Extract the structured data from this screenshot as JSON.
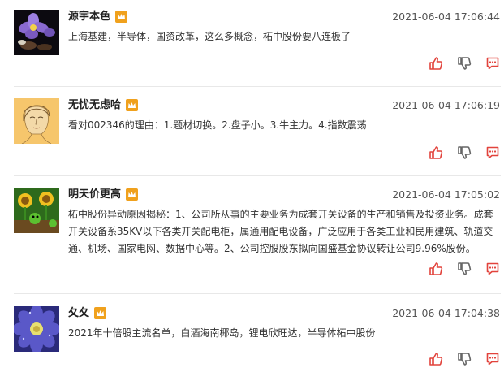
{
  "posts": [
    {
      "username": "源宇本色",
      "badge_icon": "vip-crown-icon",
      "time": "2021-06-04 17:06:44",
      "content": "上海基建，半导体，国资改革，这么多概念，柘中股份要八连板了",
      "avatar_icon": "purple-flower-avatar"
    },
    {
      "username": "无忧无虑哈",
      "badge_icon": "vip-crown-icon",
      "time": "2021-06-04 17:06:19",
      "content": "看对002346的理由：1.题材切换。2.盘子小。3.牛主力。4.指数震荡",
      "avatar_icon": "sketch-portrait-avatar"
    },
    {
      "username": "明天价更高",
      "badge_icon": "vip-crown-icon",
      "time": "2021-06-04 17:05:02",
      "content": "柘中股份异动原因揭秘：1、公司所从事的主要业务为成套开关设备的生产和销售及投资业务。成套开关设备系35KV以下各类开关配电柜，属通用配电设备，广泛应用于各类工业和民用建筑、轨道交通、机场、国家电网、数据中心等。2、公司控股股东拟向国盛基金协议转让公司9.96%股份。",
      "avatar_icon": "plants-game-avatar"
    },
    {
      "username": "夂夂",
      "badge_icon": "vip-crown-icon",
      "time": "2021-06-04 17:04:38",
      "content": "2021年十倍股主流名单，白酒海南椰岛，锂电欣旺达，半导体柘中股份",
      "avatar_icon": "blue-flower-avatar"
    }
  ],
  "action_icons": [
    "like-icon",
    "dislike-icon",
    "comment-icon"
  ],
  "colors": {
    "accent": "#e2433c",
    "crown": "#f0a11d",
    "separator": "#e8e8e8"
  }
}
